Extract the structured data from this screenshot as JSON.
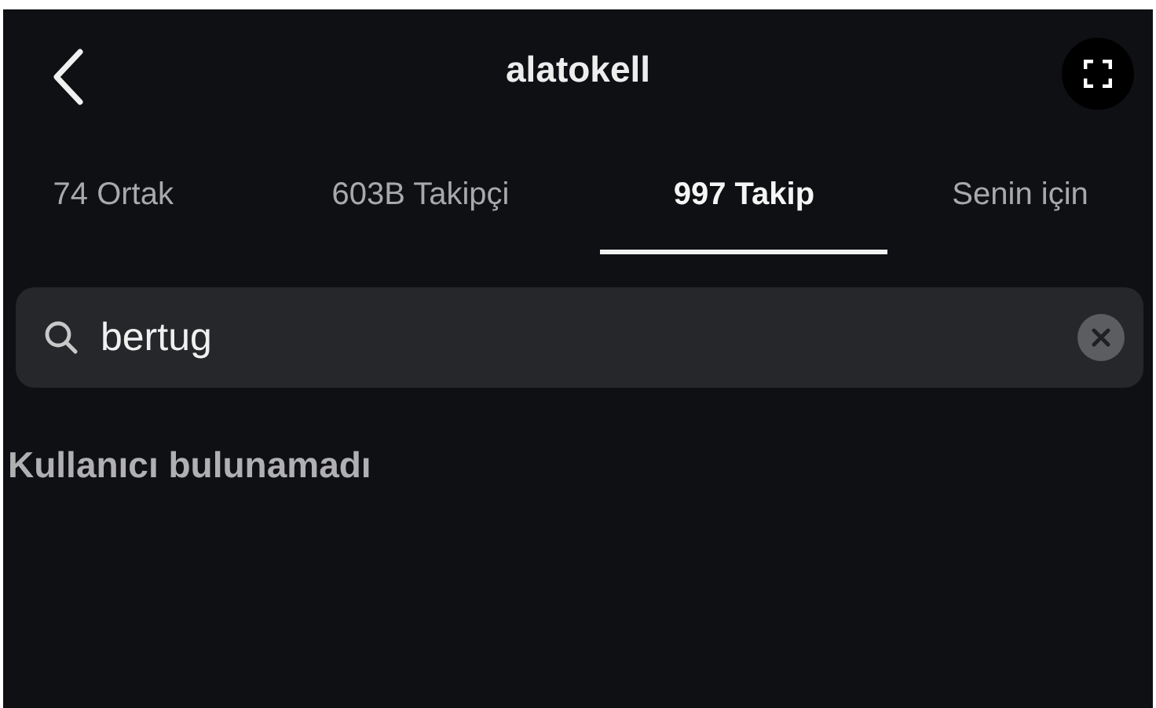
{
  "header": {
    "title": "alatokell"
  },
  "tabs": [
    {
      "label": "74 Ortak",
      "selected": false
    },
    {
      "label": "603B Takipçi",
      "selected": false
    },
    {
      "label": "997 Takip",
      "selected": true
    },
    {
      "label": "Senin için",
      "selected": false
    }
  ],
  "search": {
    "value": "bertug"
  },
  "message": "Kullanıcı bulunamadı"
}
